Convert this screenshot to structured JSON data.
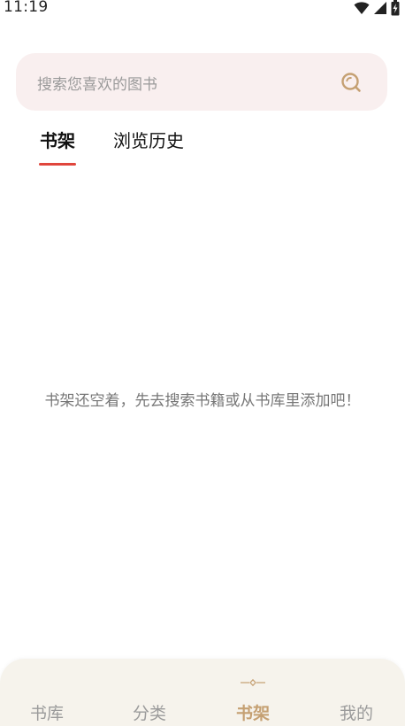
{
  "status_bar": {
    "time": "11:19"
  },
  "search": {
    "placeholder": "搜索您喜欢的图书"
  },
  "tabs": [
    {
      "label": "书架",
      "active": true
    },
    {
      "label": "浏览历史",
      "active": false
    }
  ],
  "empty_state": {
    "message": "书架还空着，先去搜索书籍或从书库里添加吧！"
  },
  "bottom_nav": {
    "items": [
      {
        "label": "书库",
        "active": false
      },
      {
        "label": "分类",
        "active": false
      },
      {
        "label": "书架",
        "active": true
      },
      {
        "label": "我的",
        "active": false
      }
    ]
  },
  "colors": {
    "accent_red": "#e0463c",
    "accent_gold": "#c5a072",
    "search_bg": "#f9efef",
    "nav_bg": "#f6f3ec"
  }
}
